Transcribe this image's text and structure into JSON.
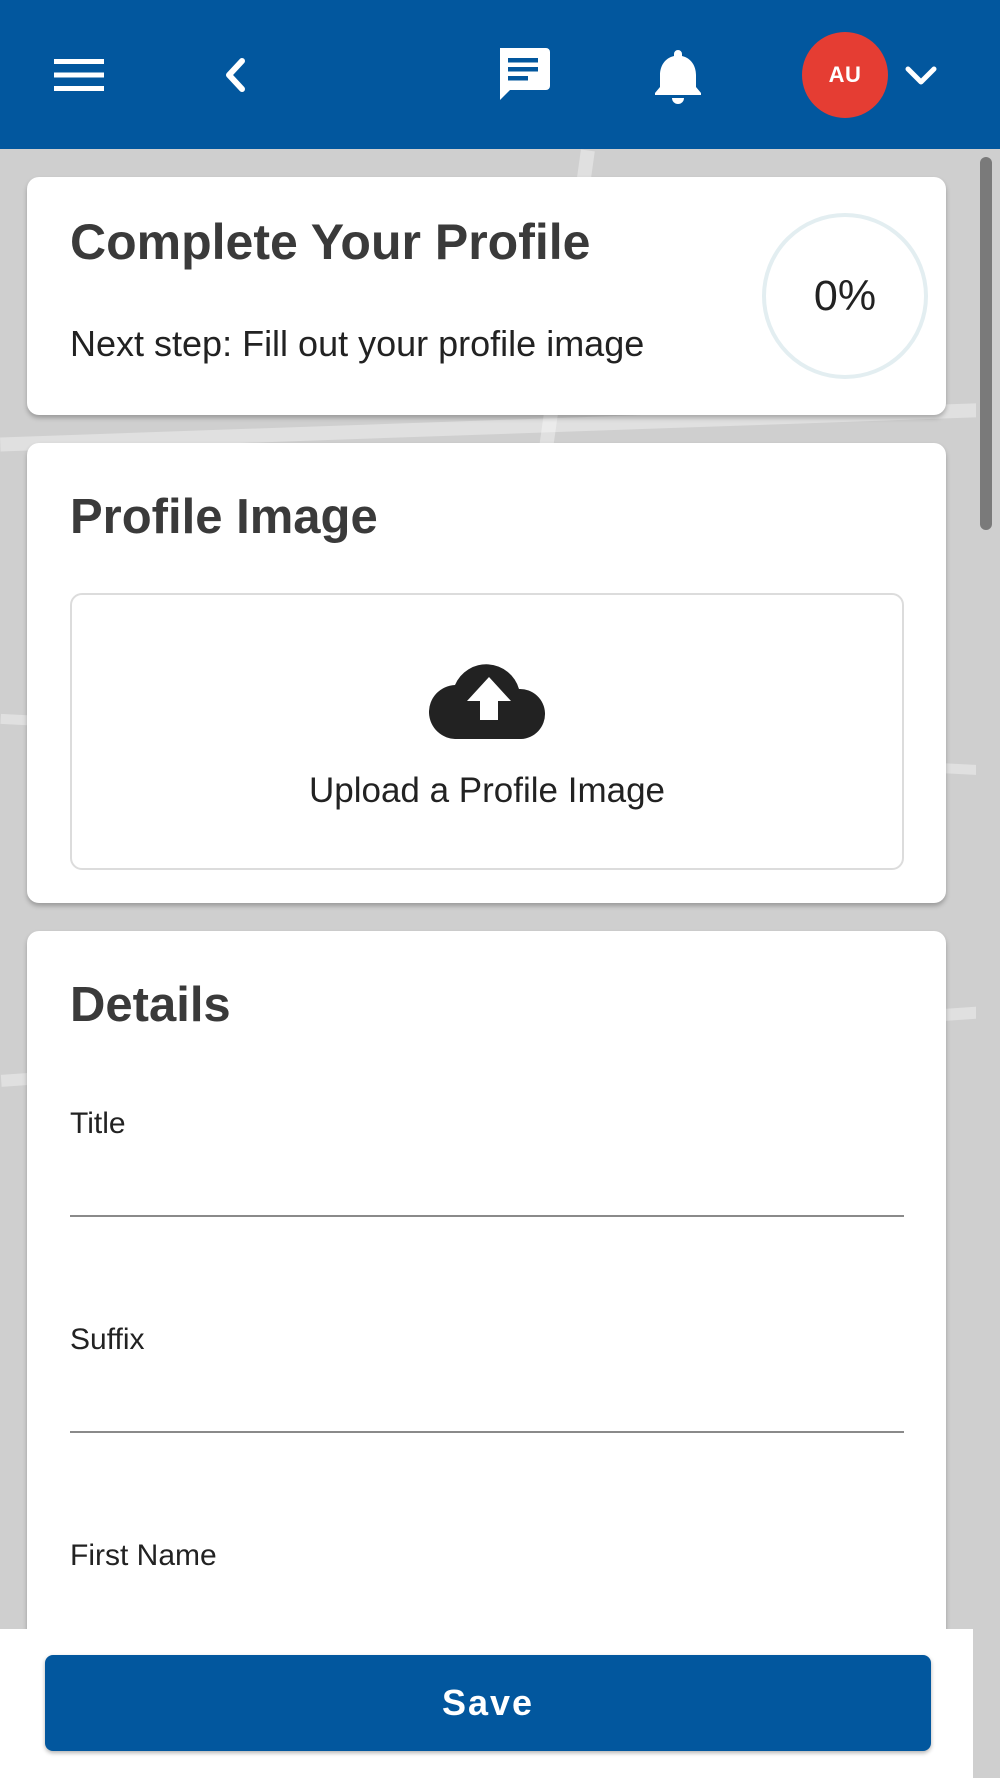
{
  "header": {
    "avatar_initials": "AU",
    "colors": {
      "bar": "#02579e",
      "avatar": "#e53d33"
    },
    "icons": [
      "menu-icon",
      "back-chevron-icon",
      "chat-icon",
      "bell-icon",
      "chevron-down-icon"
    ]
  },
  "profile_progress": {
    "title": "Complete Your Profile",
    "next_step": "Next step: Fill out your profile image",
    "percent_label": "0%",
    "percent": 0
  },
  "profile_image": {
    "title": "Profile Image",
    "upload_label": "Upload a Profile Image",
    "icon": "cloud-upload-icon"
  },
  "details": {
    "title": "Details",
    "fields": [
      {
        "label": "Title",
        "value": ""
      },
      {
        "label": "Suffix",
        "value": ""
      },
      {
        "label": "First Name",
        "value": ""
      }
    ]
  },
  "footer": {
    "save_label": "Save"
  }
}
